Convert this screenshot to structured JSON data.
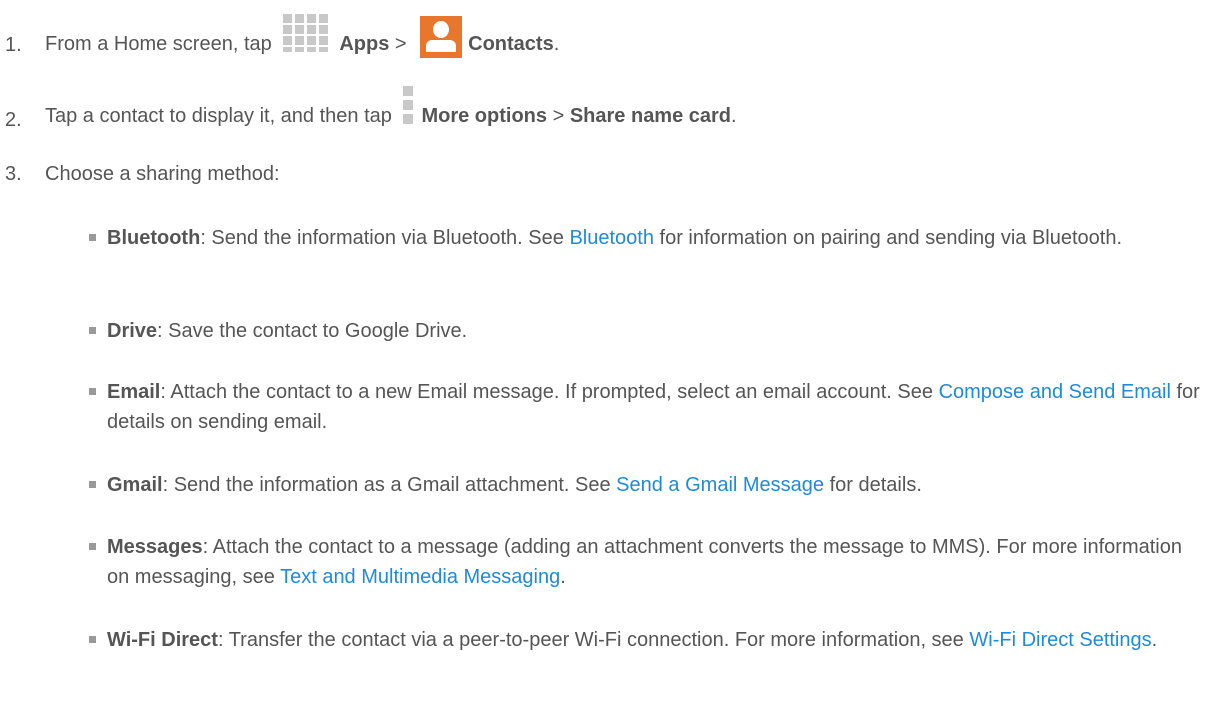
{
  "steps": [
    {
      "num": "1.",
      "a": "From a Home screen, tap",
      "apps": "Apps",
      "sep": ">",
      "contacts": "Contacts",
      "end": "."
    },
    {
      "num": "2.",
      "a": "Tap a contact to display it, and then tap",
      "more": "More options",
      "sep": ">",
      "share": "Share name card",
      "end": "."
    },
    {
      "num": "3.",
      "a": "Choose a sharing method:"
    }
  ],
  "items": [
    {
      "label": "Bluetooth",
      "pre": ": Send the information via Bluetooth. See ",
      "link": "Bluetooth",
      "post": " for information on pairing and sending via Bluetooth."
    },
    {
      "label": "Drive",
      "pre": ": Save the contact to Google Drive.",
      "link": "",
      "post": ""
    },
    {
      "label": "Email",
      "pre": ": Attach the contact to a new Email message. If prompted, select an email account. See ",
      "link": "Compose and Send Email",
      "post": " for details on sending email."
    },
    {
      "label": "Gmail",
      "pre": ": Send the information as a Gmail attachment. See ",
      "link": "Send a Gmail Message",
      "post": " for details."
    },
    {
      "label": "Messages",
      "pre": ": Attach the contact to a message (adding an attachment converts the message to MMS). For more information on messaging, see ",
      "link": "Text and Multimedia Messaging",
      "post": "."
    },
    {
      "label": "Wi-Fi Direct",
      "pre": ": Transfer the contact via a peer-to-peer Wi-Fi connection. For more information, see ",
      "link": "Wi-Fi Direct Settings",
      "post": "."
    }
  ],
  "colors": {
    "text": "#555555",
    "link": "#1f8bd8",
    "contacts_icon": "#e8762d",
    "icon_gray": "#c8c8c8"
  }
}
